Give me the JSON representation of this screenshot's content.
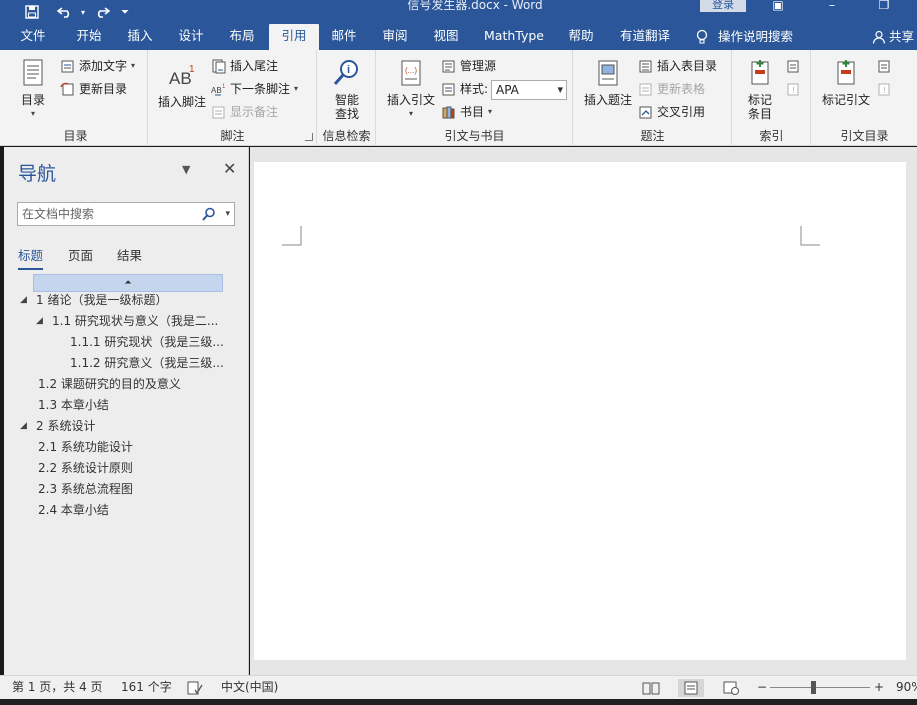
{
  "titlebar": {
    "doc_title": "信号发生器.docx - Word",
    "login": "登录"
  },
  "tabs": [
    {
      "label": "文件",
      "active": false
    },
    {
      "label": "开始",
      "active": false
    },
    {
      "label": "插入",
      "active": false
    },
    {
      "label": "设计",
      "active": false
    },
    {
      "label": "布局",
      "active": false
    },
    {
      "label": "引用",
      "active": true
    },
    {
      "label": "邮件",
      "active": false
    },
    {
      "label": "审阅",
      "active": false
    },
    {
      "label": "视图",
      "active": false
    },
    {
      "label": "MathType",
      "active": false
    },
    {
      "label": "帮助",
      "active": false
    },
    {
      "label": "有道翻译",
      "active": false
    }
  ],
  "tell_me": "操作说明搜索",
  "share": "共享",
  "ribbon": {
    "toc": {
      "label": "目录",
      "big": "目录",
      "add_text": "添加文字",
      "update_toc": "更新目录"
    },
    "footnotes": {
      "label": "脚注",
      "insert_footnote": "插入脚注",
      "insert_endnote": "插入尾注",
      "next_footnote": "下一条脚注",
      "show_notes": "显示备注"
    },
    "research": {
      "label": "信息检索",
      "smart_lookup_1": "智能",
      "smart_lookup_2": "查找"
    },
    "citations": {
      "label": "引文与书目",
      "insert_citation": "插入引文",
      "manage_sources": "管理源",
      "style_label": "样式:",
      "style_value": "APA",
      "bibliography": "书目"
    },
    "captions": {
      "label": "题注",
      "insert_caption": "插入题注",
      "insert_table_of_figures": "插入表目录",
      "update_table": "更新表格",
      "cross_reference": "交叉引用"
    },
    "index": {
      "label": "索引",
      "mark_entry_1": "标记",
      "mark_entry_2": "条目"
    },
    "toa": {
      "label": "引文目录",
      "mark_citation": "标记引文"
    }
  },
  "nav": {
    "title": "导航",
    "search_placeholder": "在文档中搜索",
    "tabs": [
      {
        "label": "标题",
        "active": true
      },
      {
        "label": "页面",
        "active": false
      },
      {
        "label": "结果",
        "active": false
      }
    ],
    "headings": [
      {
        "text": "1 绪论（我是一级标题）",
        "level": 1,
        "expand": "expanded"
      },
      {
        "text": "1.1 研究现状与意义（我是二...",
        "level": 2,
        "expand": "expanded"
      },
      {
        "text": "1.1.1 研究现状（我是三级...",
        "level": 3,
        "expand": "none"
      },
      {
        "text": "1.1.2 研究意义（我是三级...",
        "level": 3,
        "expand": "none"
      },
      {
        "text": "1.2 课题研究的目的及意义",
        "level": 2,
        "expand": "none"
      },
      {
        "text": "1.3 本章小结",
        "level": 2,
        "expand": "none"
      },
      {
        "text": "2 系统设计",
        "level": 1,
        "expand": "expanded"
      },
      {
        "text": "2.1 系统功能设计",
        "level": 2,
        "expand": "none"
      },
      {
        "text": "2.2 系统设计原则",
        "level": 2,
        "expand": "none"
      },
      {
        "text": "2.3 系统总流程图",
        "level": 2,
        "expand": "none"
      },
      {
        "text": "2.4 本章小结",
        "level": 2,
        "expand": "none"
      }
    ]
  },
  "status": {
    "page": "第 1 页，共 4 页",
    "words": "161 个字",
    "language": "中文(中国)",
    "zoom_minus": "−",
    "zoom_plus": "+",
    "zoom": "90%",
    "zoom_fraction": 0.43
  },
  "colors": {
    "word_blue": "#2b579a",
    "ribbon_bg": "#f3f3f3",
    "nav_bg": "#ededed"
  }
}
